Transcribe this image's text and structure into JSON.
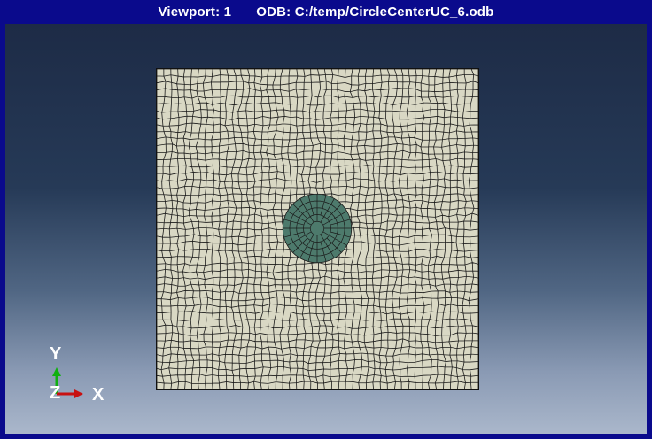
{
  "window": {
    "viewport_label": "Viewport: 1",
    "odb_label": "ODB: C:/temp/CircleCenterUC_6.odb"
  },
  "triad": {
    "y_label": "Y",
    "z_label": "Z",
    "x_label": "X",
    "colors": {
      "x": "#c81010",
      "y": "#10b010",
      "z": "#2040ff"
    }
  },
  "model": {
    "matrix_color": "#d9d8c4",
    "inclusion_color": "#4d7a6c",
    "mesh_line_color": "#1a1a1a"
  }
}
